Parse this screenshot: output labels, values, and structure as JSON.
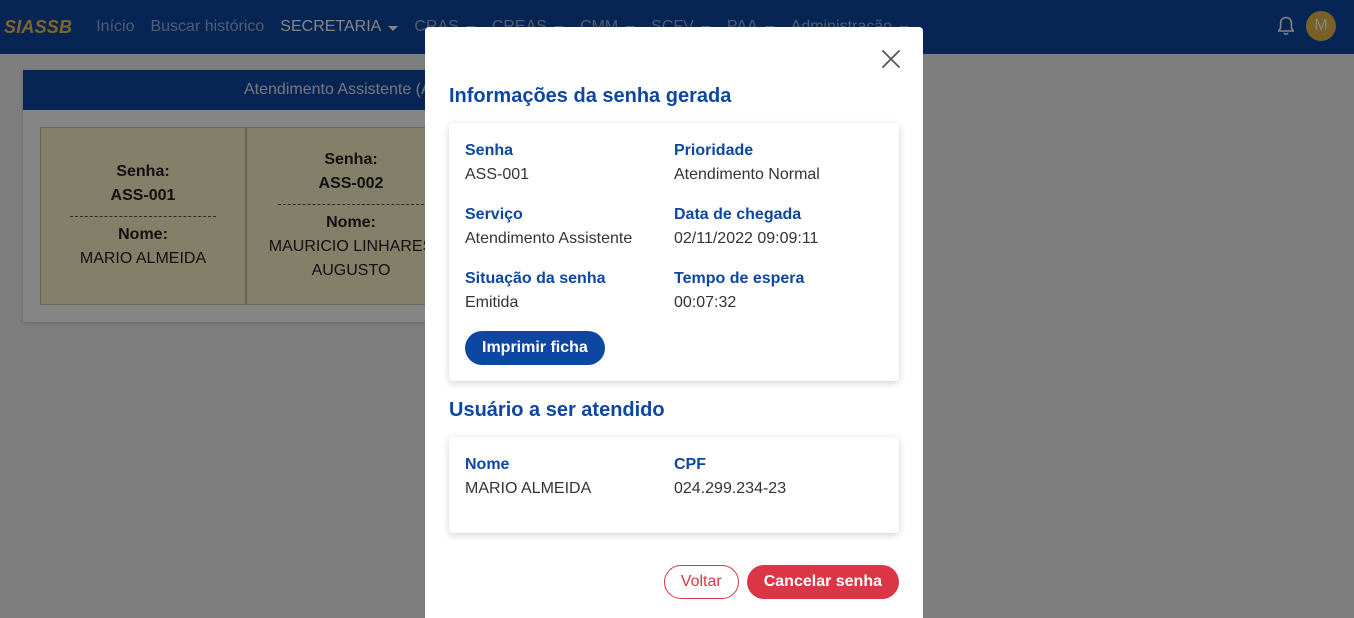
{
  "navbar": {
    "brand": "SIASSB",
    "items": [
      {
        "label": "Início",
        "dropdown": false
      },
      {
        "label": "Buscar histórico",
        "dropdown": false
      },
      {
        "label": "SECRETARIA",
        "dropdown": true
      },
      {
        "label": "CRAS",
        "dropdown": true
      },
      {
        "label": "CREAS",
        "dropdown": true
      },
      {
        "label": "CMM",
        "dropdown": true
      },
      {
        "label": "SCFV",
        "dropdown": true
      },
      {
        "label": "PAA",
        "dropdown": true
      },
      {
        "label": "Administração",
        "dropdown": true
      }
    ],
    "active_item": "SECRETARIA",
    "notification_icon": "bell-icon",
    "avatar_initial": "M"
  },
  "background": {
    "panel_title": "Atendimento Assistente (A",
    "tickets": [
      {
        "senha_label": "Senha:",
        "code": "ASS-001",
        "nome_label": "Nome:",
        "name": "MARIO ALMEIDA"
      },
      {
        "senha_label": "Senha:",
        "code": "ASS-002",
        "nome_label": "Nome:",
        "name": "MAURICIO LINHARES AUGUSTO"
      }
    ]
  },
  "modal": {
    "close_icon": "close-icon",
    "title": "Informações da senha gerada",
    "info": {
      "senha": {
        "label": "Senha",
        "value": "ASS-001"
      },
      "prioridade": {
        "label": "Prioridade",
        "value": "Atendimento Normal"
      },
      "servico": {
        "label": "Serviço",
        "value": "Atendimento Assistente"
      },
      "data_chegada": {
        "label": "Data de chegada",
        "value": "02/11/2022 09:09:11"
      },
      "situacao": {
        "label": "Situação da senha",
        "value": "Emitida"
      },
      "tempo_espera": {
        "label": "Tempo de espera",
        "value": "00:07:32"
      }
    },
    "print_button": "Imprimir ficha",
    "user_title": "Usuário a ser atendido",
    "user": {
      "nome": {
        "label": "Nome",
        "value": "MARIO ALMEIDA"
      },
      "cpf": {
        "label": "CPF",
        "value": "024.299.234-23"
      }
    },
    "back_button": "Voltar",
    "cancel_button": "Cancelar senha"
  },
  "colors": {
    "primary": "#0d47a1",
    "brand": "#f4c54b",
    "danger": "#dc3545",
    "ticket_bg": "#fbf3c7"
  }
}
